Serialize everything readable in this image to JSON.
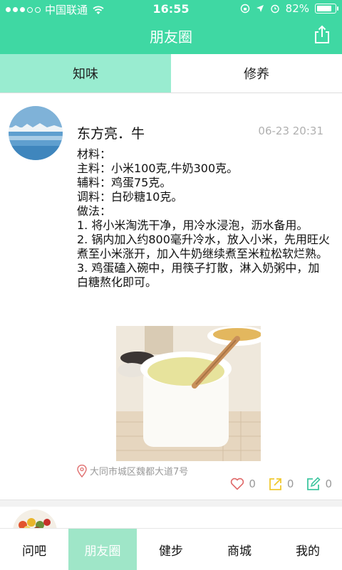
{
  "status_bar": {
    "carrier": "中国联通",
    "time": "16:55",
    "battery_percent": "82%",
    "signal_bars": 3,
    "battery_level": 0.82
  },
  "nav": {
    "title": "朋友圈"
  },
  "tabs": [
    {
      "label": "知味",
      "active": true
    },
    {
      "label": "修养",
      "active": false
    }
  ],
  "post": {
    "author": "东方亮．牛",
    "time": "06-23 20:31",
    "lines": [
      "材料：",
      "主料：小米100克,牛奶300克。",
      "辅料：鸡蛋75克。",
      "调料：白砂糖10克。",
      "做法：",
      "1. 将小米淘洗干净，用冷水浸泡，沥水备用。",
      "2. 锅内加入约800毫升冷水，放入小米，先用旺火煮至小米涨开，加入牛奶继续煮至米粒松软烂熟。",
      "3. 鸡蛋磕入碗中，用筷子打散，淋入奶粥中，加白糖熬化即可。"
    ],
    "location": "大同市城区魏都大道7号",
    "likes": "0",
    "shares": "0",
    "comments": "0"
  },
  "bottom_nav": [
    {
      "label": "问吧",
      "active": false
    },
    {
      "label": "朋友圈",
      "active": true
    },
    {
      "label": "健步",
      "active": false
    },
    {
      "label": "商城",
      "active": false
    },
    {
      "label": "我的",
      "active": false
    }
  ],
  "colors": {
    "accent": "#3fd8a3",
    "tab_active": "#99ecd0",
    "bottom_active": "#9fe6c8",
    "like": "#e06a6a",
    "share": "#f0c930",
    "comment": "#3fc6a0"
  }
}
